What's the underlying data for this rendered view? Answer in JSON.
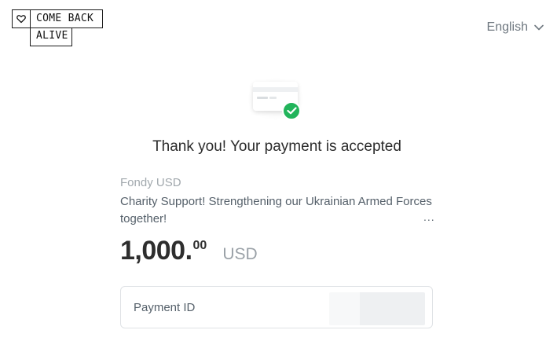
{
  "logo": {
    "line1": "COME BACK",
    "line2": "ALIVE",
    "icon": "heart-icon"
  },
  "language": {
    "selected": "English",
    "icon": "chevron-down-icon"
  },
  "illustration": {
    "icon": "card-check-icon",
    "accent_color": "#22b45b"
  },
  "status": {
    "title": "Thank you! Your payment is accepted"
  },
  "payment": {
    "merchant": "Fondy USD",
    "description": "Charity Support! Strengthening our Ukrainian Armed Forces together!",
    "more": "...",
    "amount_int": "1,000.",
    "amount_dec": "00",
    "currency": "USD"
  },
  "payment_id": {
    "label": "Payment ID"
  }
}
